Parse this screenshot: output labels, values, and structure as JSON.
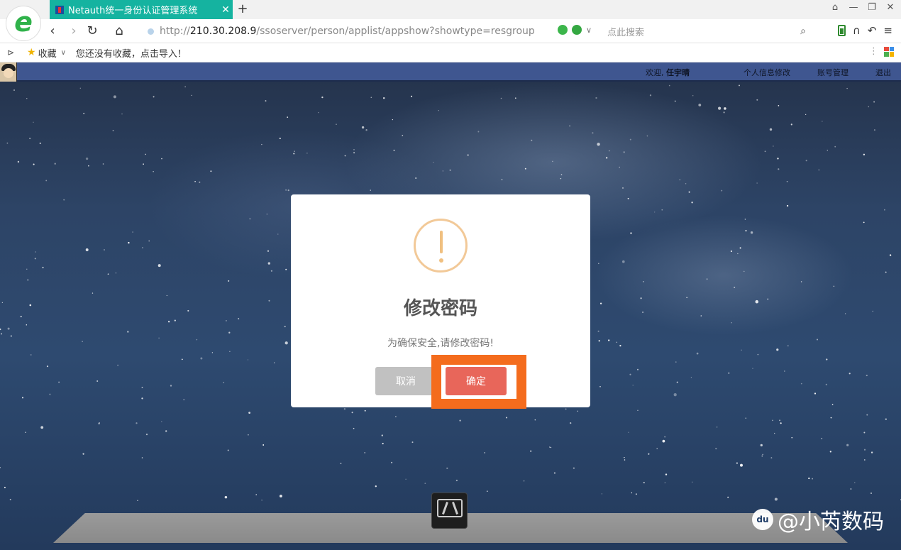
{
  "browser": {
    "tab_title": "Netauth统一身份认证管理系统",
    "tab_close": "✕",
    "new_tab": "+",
    "url_scheme": "http://",
    "url_host": "210.30.208.9",
    "url_path": "/ssoserver/person/applist/appshow?showtype=resgroup",
    "search_placeholder": "点此搜索",
    "bookmarks_label": "收藏",
    "bookmarks_empty": "您还没有收藏，点击导入！"
  },
  "page": {
    "welcome_prefix": "欢迎, ",
    "user_name": "任宇晴",
    "nav": [
      "个人信息修改",
      "账号管理",
      "退出"
    ]
  },
  "dialog": {
    "title": "修改密码",
    "message": "为确保安全,请修改密码!",
    "cancel_label": "取消",
    "confirm_label": "确定"
  },
  "watermark": {
    "text": "@小芮数码",
    "badge": "du"
  },
  "colors": {
    "tab_accent": "#15b3a0",
    "header_bar": "#3f5690",
    "confirm_button": "#e8665a",
    "cancel_button": "#c1c1c1",
    "highlight_box": "#f46c1d",
    "warning_icon": "#f2c998"
  },
  "icons": [
    "browser-logo-icon",
    "back-icon",
    "forward-icon",
    "reload-icon",
    "home-icon",
    "search-icon",
    "warning-icon",
    "star-icon"
  ]
}
